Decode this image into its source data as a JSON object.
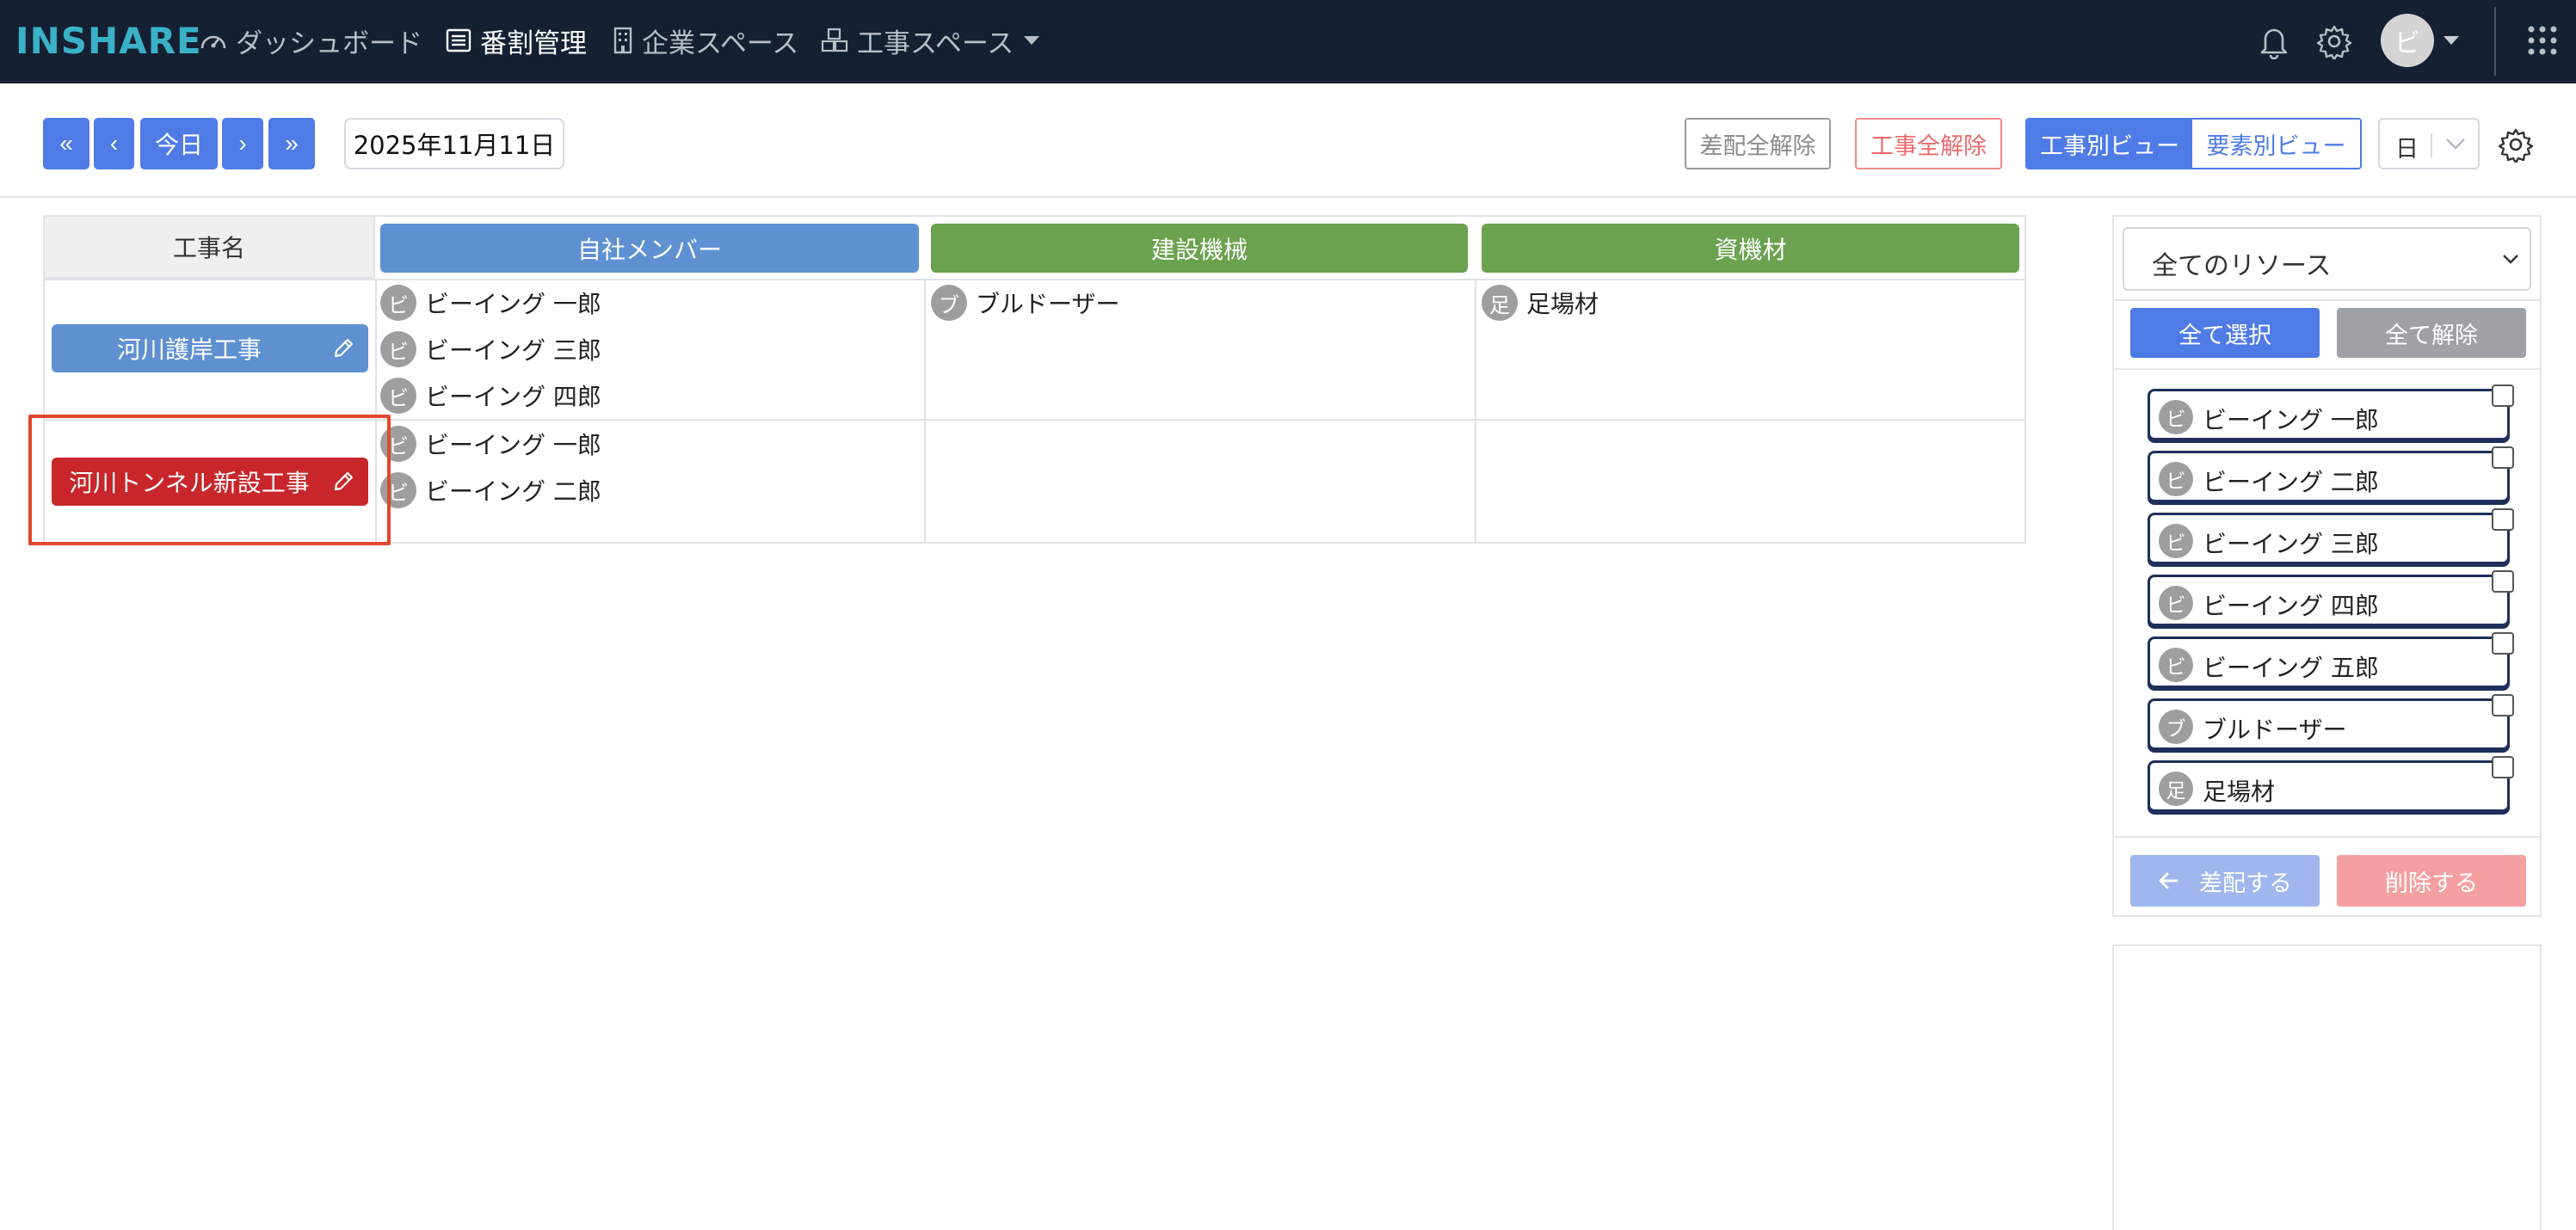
{
  "navbar": {
    "logo": "INSHARE",
    "items": [
      {
        "label": "ダッシュボード"
      },
      {
        "label": "番割管理"
      },
      {
        "label": "企業スペース"
      },
      {
        "label": "工事スペース"
      }
    ],
    "avatar": "ビ"
  },
  "toolbar": {
    "first_label": "«",
    "prev_label": "‹",
    "today_label": "今日",
    "next_label": "›",
    "last_label": "»",
    "date": "2025年11月11日",
    "clear_assign_label": "差配全解除",
    "clear_project_label": "工事全解除",
    "view_by_project": "工事別ビュー",
    "view_by_element": "要素別ビュー",
    "unit": "日"
  },
  "table": {
    "name_header": "工事名",
    "category_headers": [
      "自社メンバー",
      "建設機械",
      "資機材"
    ],
    "rows": [
      {
        "project": "河川護岸工事",
        "members": [
          {
            "icon": "ビ",
            "name": "ビーイング 一郎"
          },
          {
            "icon": "ビ",
            "name": "ビーイング 三郎"
          },
          {
            "icon": "ビ",
            "name": "ビーイング 四郎"
          }
        ],
        "machines": [
          {
            "icon": "ブ",
            "name": "ブルドーザー"
          }
        ],
        "materials": [
          {
            "icon": "足",
            "name": "足場材"
          }
        ]
      },
      {
        "project": "河川トンネル新設工事",
        "members": [
          {
            "icon": "ビ",
            "name": "ビーイング 一郎"
          },
          {
            "icon": "ビ",
            "name": "ビーイング 二郎"
          }
        ],
        "machines": [],
        "materials": []
      }
    ]
  },
  "panel": {
    "filter": "全てのリソース",
    "select_all": "全て選択",
    "clear_all": "全て解除",
    "resources": [
      {
        "icon": "ビ",
        "name": "ビーイング 一郎"
      },
      {
        "icon": "ビ",
        "name": "ビーイング 二郎"
      },
      {
        "icon": "ビ",
        "name": "ビーイング 三郎"
      },
      {
        "icon": "ビ",
        "name": "ビーイング 四郎"
      },
      {
        "icon": "ビ",
        "name": "ビーイング 五郎"
      },
      {
        "icon": "ブ",
        "name": "ブルドーザー"
      },
      {
        "icon": "足",
        "name": "足場材"
      }
    ],
    "assign_label": "差配する",
    "delete_label": "削除する"
  },
  "colors": {
    "navbar": "#152032",
    "primary": "#4f7be7",
    "member_header": "#5e90d2",
    "machine_header": "#6ba24f",
    "project_selected": "#c8262b",
    "highlight": "#e0462f"
  }
}
